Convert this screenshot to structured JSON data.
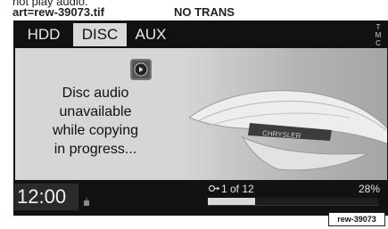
{
  "caption": {
    "line1": "not play audio.",
    "line2": "art=rew-39073.tif",
    "no_trans": "NO TRANS"
  },
  "tabs": [
    {
      "label": "HDD",
      "selected": false
    },
    {
      "label": "DISC",
      "selected": true
    },
    {
      "label": "AUX",
      "selected": false
    }
  ],
  "tmc_label": "TMC",
  "message": {
    "lines": [
      "Disc audio",
      "unavailable",
      "while copying",
      "in progress..."
    ]
  },
  "emblem_text": "CHRYSLER",
  "status": {
    "time": "12:00",
    "track": "1 of 12",
    "percent": "28%",
    "progress": 0.28
  },
  "art_label": "rew-39073",
  "colors": {
    "screen_bg": "#141414",
    "content_bg": "#d6d6d6",
    "tab_selected_bg": "#d9d9d9"
  },
  "icons": {
    "disc": "disc-icon",
    "track": "track-icon",
    "radio": "radio-icon"
  }
}
